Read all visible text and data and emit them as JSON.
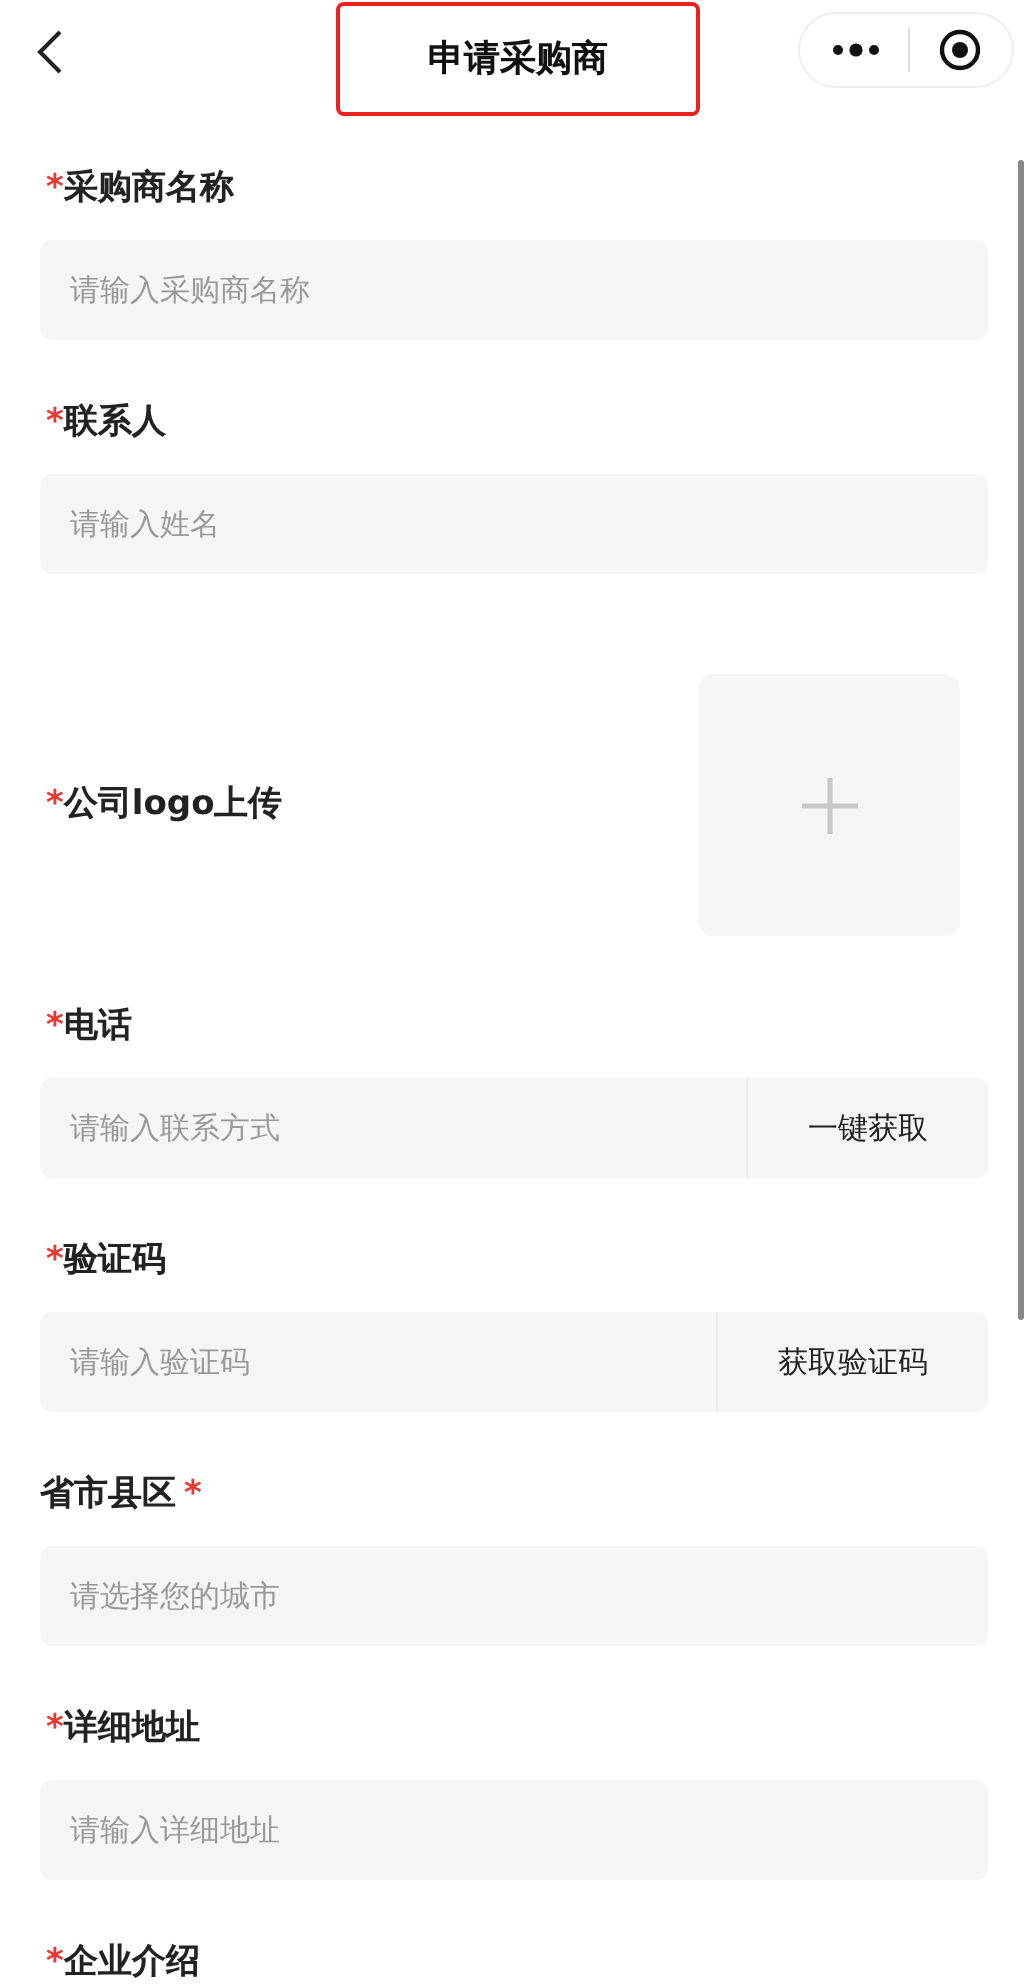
{
  "nav": {
    "title": "申请采购商",
    "title_highlighted": true
  },
  "fields": [
    {
      "kind": "text",
      "required_before": "*",
      "label": "采购商名称",
      "placeholder": "请输入采购商名称"
    },
    {
      "kind": "text",
      "required_before": "*",
      "label": "联系人",
      "placeholder": "请输入姓名"
    },
    {
      "kind": "upload",
      "required_before": "*",
      "label": "公司logo上传"
    },
    {
      "kind": "action",
      "required_before": "*",
      "label": "电话",
      "placeholder": "请输入联系方式",
      "action": "一键获取"
    },
    {
      "kind": "action",
      "required_before": "*",
      "label": "验证码",
      "placeholder": "请输入验证码",
      "action": "获取验证码"
    },
    {
      "kind": "text",
      "label": "省市县区",
      "required_after": "*",
      "placeholder": "请选择您的城市"
    },
    {
      "kind": "text",
      "required_before": "*",
      "label": "详细地址",
      "placeholder": "请输入详细地址"
    },
    {
      "kind": "label_only",
      "required_before": "*",
      "label": "企业介绍"
    }
  ]
}
